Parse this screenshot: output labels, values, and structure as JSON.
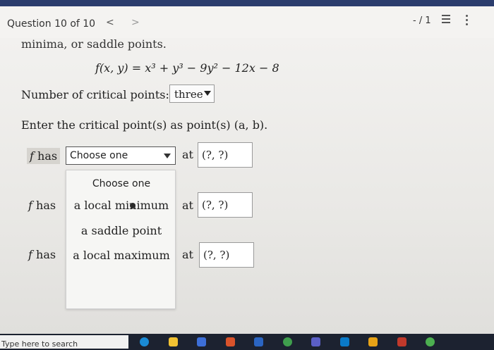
{
  "header": {
    "question_label": "Question 10 of 10",
    "prev_glyph": "<",
    "next_glyph": ">",
    "score": "- / 1",
    "list_icon": "list-icon",
    "more_icon": "kebab-menu-icon"
  },
  "problem": {
    "cut_text": "minima, or saddle points.",
    "equation": {
      "lhs": "f(x, y) = ",
      "rhs": "x³ + y³ − 9y² − 12x − 8"
    },
    "critical_count_label": "Number of critical points:",
    "critical_count_value": "three",
    "instructions": "Enter the critical point(s) as point(s) (a, b)."
  },
  "rows": [
    {
      "f": "f",
      "has": "has",
      "selected": "Choose one",
      "at": "at",
      "point": "(?, ?)"
    },
    {
      "f": "f",
      "has": "has",
      "at": "at",
      "point": "(?, ?)"
    },
    {
      "f": "f",
      "has": "has",
      "at": "at",
      "point": "(?, ?)"
    }
  ],
  "dropdown_options": [
    "Choose one",
    "a local minimum",
    "a saddle point",
    "a local maximum"
  ],
  "taskbar": {
    "search_placeholder": "Type here to search",
    "icons": [
      "edge-icon",
      "file-explorer-icon",
      "store-icon",
      "office-icon",
      "word-icon",
      "chrome-icon",
      "teams-icon",
      "mail-icon",
      "folder-icon",
      "app-icon",
      "chrome-alt-icon"
    ],
    "icon_colors": [
      "#1a8bd6",
      "#f2c233",
      "#3d6fd8",
      "#d9532b",
      "#2b65c2",
      "#3f9e4d",
      "#5b5fc7",
      "#0a7ac9",
      "#e8a317",
      "#c0392b",
      "#4caf50"
    ]
  },
  "colors": {
    "header_strip": "#2b3d6d",
    "taskbar": "#1c2230"
  }
}
